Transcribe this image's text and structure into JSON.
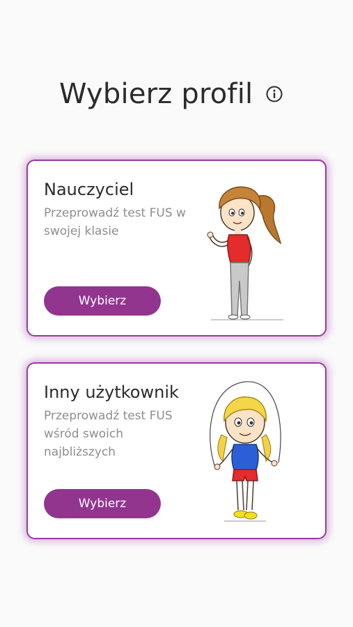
{
  "header": {
    "title": "Wybierz profil",
    "info_icon": "info-circle-icon"
  },
  "profiles": [
    {
      "title": "Nauczyciel",
      "description": "Przeprowadź test FUS w swojej klasie",
      "button_label": "Wybierz",
      "illustration": "teacher-girl-illustration"
    },
    {
      "title": "Inny użytkownik",
      "description": "Przeprowadź test FUS wśród swoich najbliższych",
      "button_label": "Wybierz",
      "illustration": "jump-rope-girl-illustration"
    }
  ],
  "colors": {
    "accent": "#92358f",
    "card_border": "#9b3a9c",
    "text_primary": "#2b2b2b",
    "text_secondary": "#8e8e8e",
    "background": "#fafafa"
  }
}
